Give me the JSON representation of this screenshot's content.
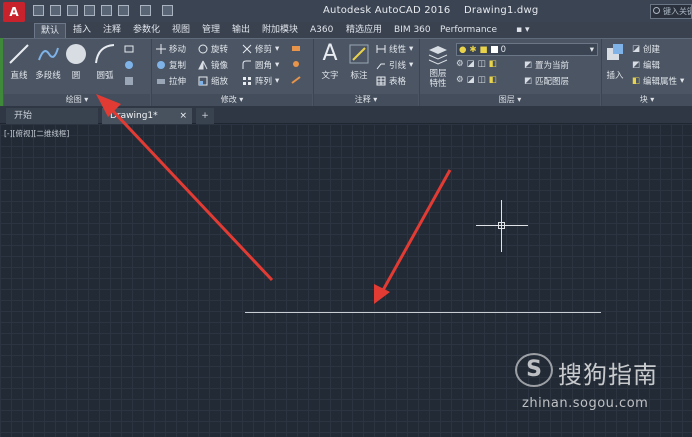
{
  "titlebar": {
    "title": "Autodesk AutoCAD 2016    Drawing1.dwg",
    "app_button": "A",
    "search_placeholder": "键入关键字"
  },
  "tabs": [
    "默认",
    "插入",
    "注释",
    "参数化",
    "视图",
    "管理",
    "输出",
    "附加模块",
    "A360",
    "精选应用",
    "BIM 360",
    "Performance"
  ],
  "ribbon": {
    "draw": {
      "title": "绘图",
      "line": "直线",
      "polyline": "多段线",
      "circle": "圆",
      "arc": "圆弧"
    },
    "modify": {
      "title": "修改",
      "move": "移动",
      "rotate": "旋转",
      "trim": "修剪",
      "copy": "复制",
      "mirror": "镜像",
      "fillet": "圆角",
      "stretch": "拉伸",
      "scale": "缩放",
      "array": "阵列"
    },
    "annotation": {
      "title": "注释",
      "text": "文字",
      "dimension": "标注",
      "linear": "线性",
      "leader": "引线",
      "table": "表格"
    },
    "layers": {
      "title": "图层",
      "layer_properties": "图层\n特性",
      "current_layer": "0",
      "set_current": "置为当前",
      "match_layer": "匹配图层"
    },
    "block": {
      "title": "块",
      "insert": "插入",
      "create": "创建",
      "edit": "编辑",
      "edit_attributes": "编辑属性"
    }
  },
  "file_tabs": {
    "start": "开始",
    "drawing": "Drawing1*"
  },
  "canvas": {
    "viewport_label": "[-][俯视][二维线框]"
  },
  "watermark": {
    "logo": "S",
    "brand": "搜狗指南",
    "url": "zhinan.sogou.com"
  },
  "colors": {
    "annotation_arrow": "#e23b34",
    "canvas_bg": "#222a35",
    "ribbon_bg": "#4b5564",
    "app_button": "#c8232c"
  }
}
